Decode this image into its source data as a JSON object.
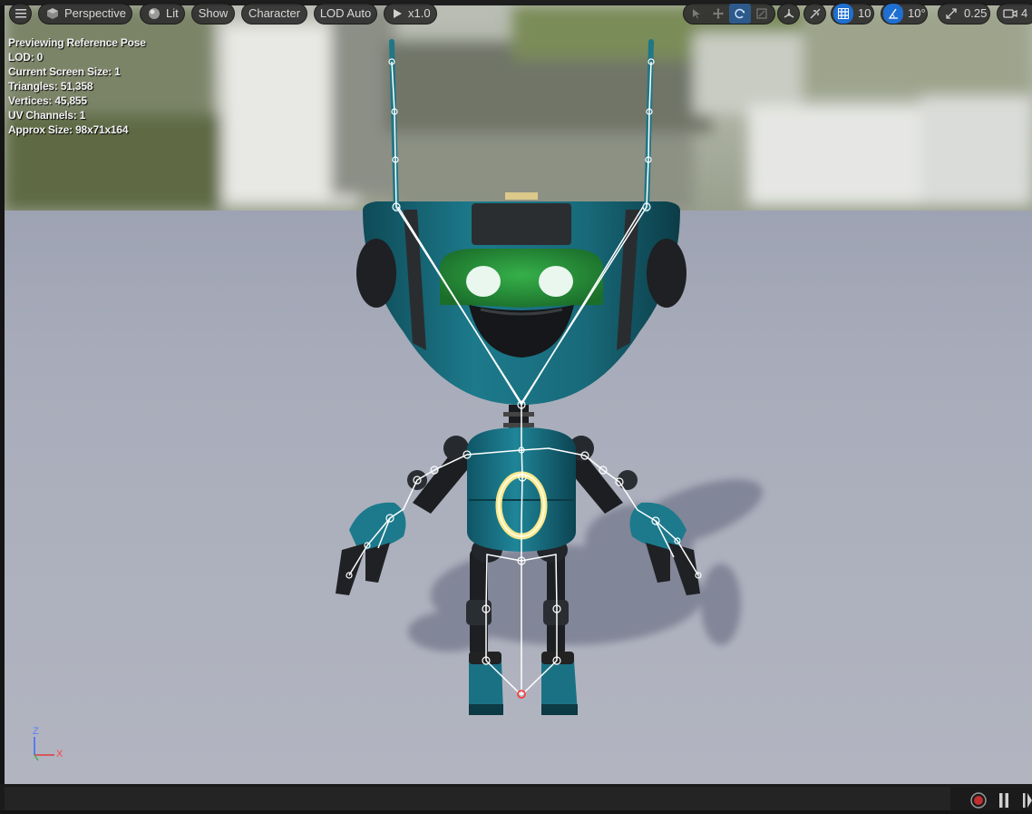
{
  "toolbar": {
    "menu_icon": "hamburger-menu-icon",
    "perspective_label": "Perspective",
    "lit_label": "Lit",
    "show_label": "Show",
    "character_label": "Character",
    "lod_label": "LOD Auto",
    "play_speed_label": "x1.0",
    "grid_snap_value": "10",
    "rotation_snap_value": "10°",
    "scale_snap_value": "0.25",
    "camera_speed_value": "4"
  },
  "stats": {
    "line1": "Previewing Reference Pose",
    "line2": "LOD: 0",
    "line3": "Current Screen Size: 1",
    "line4": "Triangles: 51,358",
    "line5": "Vertices: 45,855",
    "line6": "UV Channels: 1",
    "line7": "Approx Size: 98x71x164"
  },
  "axis": {
    "z": "Z",
    "x": "X"
  },
  "colors": {
    "floor": "#a9adba",
    "robot_teal": "#1a6f80",
    "face_green": "#2a9a3a",
    "ring_yellow": "#f4e48a",
    "active_blue": "#1f6fd1",
    "record_red": "#c03030"
  }
}
